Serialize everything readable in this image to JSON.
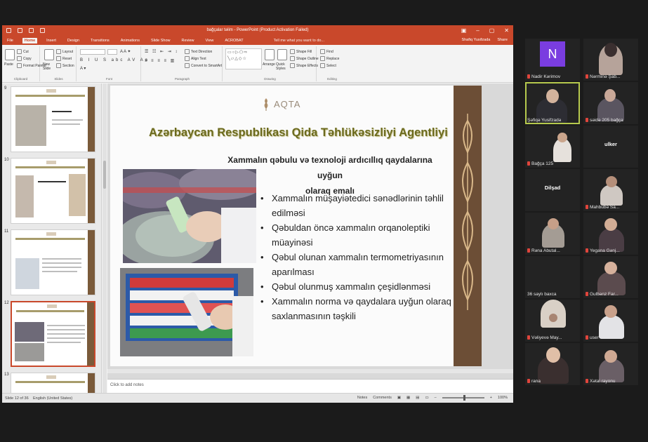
{
  "ppt": {
    "title": "bağçalar təlim - PowerPoint (Product Activation Failed)",
    "user": "Shafiq Yusifzada",
    "tabs": [
      "File",
      "Home",
      "Insert",
      "Design",
      "Transitions",
      "Animations",
      "Slide Show",
      "Review",
      "View",
      "ACROBAT"
    ],
    "tellme": "Tell me what you want to do...",
    "share": "Share",
    "ribbon": {
      "cut": "Cut",
      "copy": "Copy",
      "format_painter": "Format Painter",
      "paste": "Paste",
      "new_slide": "New Slide",
      "layout": "Layout",
      "reset": "Reset",
      "section": "Section",
      "text_direction": "Text Direction",
      "align_text": "Align Text",
      "convert_smartart": "Convert to SmartArt",
      "arrange": "Arrange",
      "quick_styles": "Quick Styles",
      "shape_fill": "Shape Fill",
      "shape_outline": "Shape Outline",
      "shape_effects": "Shape Effects",
      "find": "Find",
      "replace": "Replace",
      "select": "Select",
      "groups": [
        "Clipboard",
        "Slides",
        "Font",
        "Paragraph",
        "Drawing",
        "Editing"
      ]
    },
    "thumbnails": [
      {
        "num": "9",
        "title": "Azərbaycan Respublikası Qida Təhlükəsizliyi Agentliyi"
      },
      {
        "num": "10",
        "title": "Azərbaycan Respublikası Qida Təhlükəsizliyi Agentliyi"
      },
      {
        "num": "11",
        "title": "Azərbaycan Respublikası Qida Təhlükəsizliyi Agentliyi"
      },
      {
        "num": "12",
        "title": "Azərbaycan Respublikası Qida Təhlükəsizliyi Agentliyi"
      },
      {
        "num": "13",
        "title": "Azərbaycan Respublikası Qida Təhlükəsizliyi Agentliyi"
      }
    ],
    "slide": {
      "logo": "AQTA",
      "title": "Azərbaycan Respublikası Qida Təhlükəsizliyi Agentliyi",
      "subtitle_line1": "Xammalın qəbulu və texnoloji ardıcıllıq qaydalarına uyğun",
      "subtitle_line2": "olaraq emalı",
      "bullets": [
        "Xammalın müşayiətedici sənədlərinin təhlil edilməsi",
        "Qəbuldan öncə xammalın orqanoleptiki müayinəsi",
        "Qəbul olunan xammalın termometriyasının aparılması",
        "Qəbul olunmuş xammalın çeşidlənməsi",
        "Xammalın norma və qaydalara uyğun olaraq saxlanmasının təşkili"
      ]
    },
    "notes_placeholder": "Click to add notes",
    "status": {
      "slide_of": "Slide 12 of 36",
      "language": "English (United States)",
      "notes": "Notes",
      "comments": "Comments",
      "zoom": "100%"
    },
    "colors": {
      "accent": "#c9482b",
      "title_olive": "#6b6a1e",
      "band_brown": "#6c4e36"
    }
  },
  "participants": [
    {
      "name": "Nadir Kərimov",
      "type": "avatar",
      "initial": "N"
    },
    {
      "name": "Nərminə Şab...",
      "type": "video"
    },
    {
      "name": "Şəfiqə Yusifzadə",
      "type": "video",
      "active": true
    },
    {
      "name": "səidə 205 bağça",
      "type": "video"
    },
    {
      "name": "Bağça 125",
      "type": "video"
    },
    {
      "name": "ulker",
      "type": "label"
    },
    {
      "name": "Dilşad",
      "type": "label"
    },
    {
      "name": "Mahbubə Sa...",
      "type": "video"
    },
    {
      "name": "Rəna Abutal...",
      "type": "video"
    },
    {
      "name": "Yegana Gənj...",
      "type": "video"
    },
    {
      "name": "36 saylı baxca",
      "type": "label_bottom"
    },
    {
      "name": "Gulbənz Far...",
      "type": "video"
    },
    {
      "name": "Vəliyevə May...",
      "type": "video"
    },
    {
      "name": "user",
      "type": "video"
    },
    {
      "name": "rana",
      "type": "video"
    },
    {
      "name": "Xətai rayonu",
      "type": "video"
    }
  ]
}
